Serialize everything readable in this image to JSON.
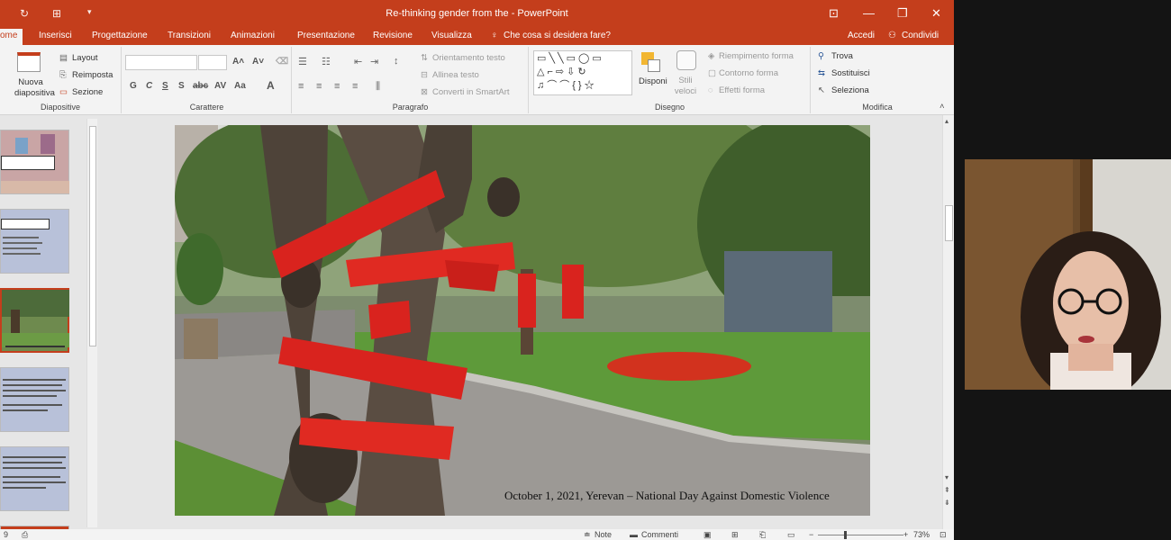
{
  "window": {
    "title": "Re-thinking gender from the - PowerPoint",
    "controls": [
      "⊡",
      "—",
      "❐",
      "✕"
    ]
  },
  "tabs": [
    {
      "label": "Home",
      "visible_label": "ome",
      "active": true
    },
    {
      "label": "Inserisci"
    },
    {
      "label": "Progettazione"
    },
    {
      "label": "Transizioni"
    },
    {
      "label": "Animazioni"
    },
    {
      "label": "Presentazione"
    },
    {
      "label": "Revisione"
    },
    {
      "label": "Visualizza"
    },
    {
      "label": "Che cosa si desidera fare?"
    }
  ],
  "account": {
    "login": "Accedi",
    "share": "Condividi"
  },
  "ribbon": {
    "slides_group": {
      "new_slide": "Nuova diapositiva",
      "layout": "Layout",
      "reset": "Reimposta",
      "section": "Sezione",
      "label": "Diapositive"
    },
    "font_group": {
      "label": "Carattere",
      "buttons": [
        "G",
        "C",
        "S",
        "S",
        "abc",
        "AV",
        "Aa",
        "A"
      ]
    },
    "paragraph_group": {
      "label": "Paragrafo",
      "text_direction": "Orientamento testo",
      "align_text": "Allinea testo",
      "smartart": "Converti in SmartArt"
    },
    "drawing_group": {
      "label": "Disegno",
      "arrange": "Disponi",
      "quick_styles": "Stili veloci",
      "shape_fill": "Riempimento forma",
      "shape_outline": "Contorno forma",
      "shape_effects": "Effetti forma"
    },
    "editing_group": {
      "label": "Modifica",
      "find": "Trova",
      "replace": "Sostituisci",
      "select": "Seleziona"
    }
  },
  "thumbnails": [
    {
      "number": "",
      "kind": "title",
      "active": false
    },
    {
      "number": "",
      "kind": "text",
      "active": false
    },
    {
      "number": "",
      "kind": "photo",
      "active": true
    },
    {
      "number": "",
      "kind": "text",
      "active": false
    },
    {
      "number": "",
      "kind": "text",
      "active": false
    }
  ],
  "slide": {
    "caption": "October 1, 2021, Yerevan – National Day Against Domestic Violence"
  },
  "statusbar": {
    "slide_number": "9",
    "notes": "Note",
    "comments": "Commenti",
    "zoom": "73%"
  },
  "colors": {
    "accent": "#c43e1c",
    "ribbon_bg": "#f3f3f3",
    "ribbon_tape": "#d9231e"
  }
}
